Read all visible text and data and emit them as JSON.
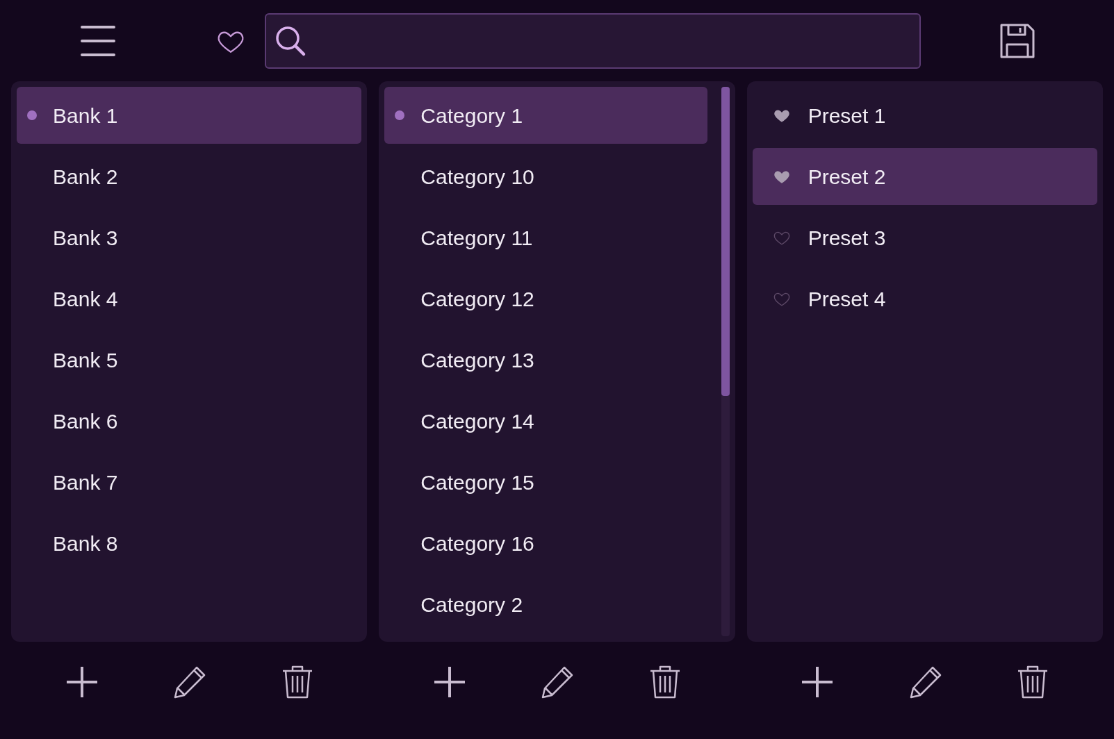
{
  "panels": [
    {
      "kind": "bank",
      "items": [
        {
          "label": "Bank 1",
          "selected": true
        },
        {
          "label": "Bank 2",
          "selected": false
        },
        {
          "label": "Bank 3",
          "selected": false
        },
        {
          "label": "Bank 4",
          "selected": false
        },
        {
          "label": "Bank 5",
          "selected": false
        },
        {
          "label": "Bank 6",
          "selected": false
        },
        {
          "label": "Bank 7",
          "selected": false
        },
        {
          "label": "Bank 8",
          "selected": false
        }
      ]
    },
    {
      "kind": "category",
      "items": [
        {
          "label": "Category 1",
          "selected": true
        },
        {
          "label": "Category 10",
          "selected": false
        },
        {
          "label": "Category 11",
          "selected": false
        },
        {
          "label": "Category 12",
          "selected": false
        },
        {
          "label": "Category 13",
          "selected": false
        },
        {
          "label": "Category 14",
          "selected": false
        },
        {
          "label": "Category 15",
          "selected": false
        },
        {
          "label": "Category 16",
          "selected": false
        },
        {
          "label": "Category 2",
          "selected": false
        }
      ]
    },
    {
      "kind": "preset",
      "items": [
        {
          "label": "Preset 1",
          "selected": false,
          "favorite": true
        },
        {
          "label": "Preset 2",
          "selected": true,
          "favorite": true
        },
        {
          "label": "Preset 3",
          "selected": false,
          "favorite": false
        },
        {
          "label": "Preset 4",
          "selected": false,
          "favorite": false
        }
      ]
    }
  ]
}
